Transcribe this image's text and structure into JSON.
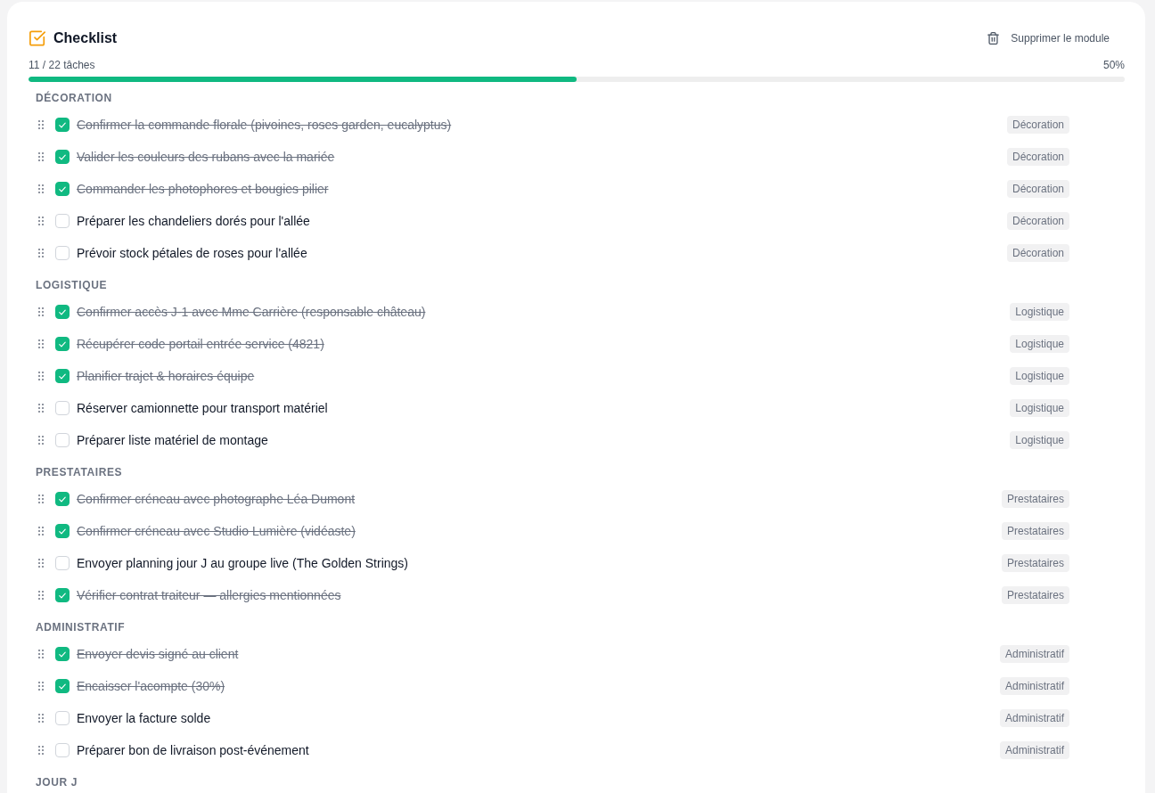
{
  "module": {
    "title": "Checklist",
    "delete_label": "Supprimer le module"
  },
  "progress": {
    "count": "11 / 22 tâches",
    "percent": "50%",
    "level": 0.5
  },
  "sections": [
    {
      "title": "DÉCORATION",
      "tasks": [
        {
          "label": "Confirmer la commande florale (pivoines, roses garden, eucalyptus)",
          "checked": true,
          "tag": "Décoration"
        },
        {
          "label": "Valider les couleurs des rubans avec la mariée",
          "checked": true,
          "tag": "Décoration"
        },
        {
          "label": "Commander les photophores et bougies pilier",
          "checked": true,
          "tag": "Décoration"
        },
        {
          "label": "Préparer les chandeliers dorés pour l'allée",
          "checked": false,
          "tag": "Décoration"
        },
        {
          "label": "Prévoir stock pétales de roses pour l'allée",
          "checked": false,
          "tag": "Décoration"
        }
      ]
    },
    {
      "title": "LOGISTIQUE",
      "tasks": [
        {
          "label": "Confirmer accès J-1 avec Mme Carrière (responsable château)",
          "checked": true,
          "tag": "Logistique"
        },
        {
          "label": "Récupérer code portail entrée service (4821)",
          "checked": true,
          "tag": "Logistique"
        },
        {
          "label": "Planifier trajet & horaires équipe",
          "checked": true,
          "tag": "Logistique"
        },
        {
          "label": "Réserver camionnette pour transport matériel",
          "checked": false,
          "tag": "Logistique"
        },
        {
          "label": "Préparer liste matériel de montage",
          "checked": false,
          "tag": "Logistique"
        }
      ]
    },
    {
      "title": "PRESTATAIRES",
      "tasks": [
        {
          "label": "Confirmer créneau avec photographe Léa Dumont",
          "checked": true,
          "tag": "Prestataires"
        },
        {
          "label": "Confirmer créneau avec Studio Lumière (vidéaste)",
          "checked": true,
          "tag": "Prestataires"
        },
        {
          "label": "Envoyer planning jour J au groupe live (The Golden Strings)",
          "checked": false,
          "tag": "Prestataires"
        },
        {
          "label": "Vérifier contrat traiteur — allergies mentionnées",
          "checked": true,
          "tag": "Prestataires"
        }
      ]
    },
    {
      "title": "ADMINISTRATIF",
      "tasks": [
        {
          "label": "Envoyer devis signé au client",
          "checked": true,
          "tag": "Administratif"
        },
        {
          "label": "Encaisser l'acompte (30%)",
          "checked": true,
          "tag": "Administratif"
        },
        {
          "label": "Envoyer la facture solde",
          "checked": false,
          "tag": "Administratif"
        },
        {
          "label": "Préparer bon de livraison post-événement",
          "checked": false,
          "tag": "Administratif"
        }
      ]
    },
    {
      "title": "JOUR J"
    }
  ]
}
